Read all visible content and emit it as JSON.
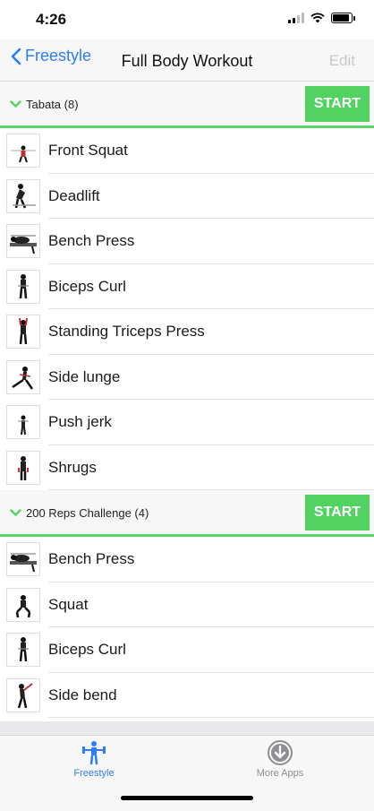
{
  "status": {
    "time": "4:26"
  },
  "nav": {
    "back_label": "Freestyle",
    "title": "Full Body Workout",
    "edit_label": "Edit"
  },
  "sections": [
    {
      "title": "Tabata (8)",
      "start_label": "START",
      "items": [
        {
          "name": "Front Squat"
        },
        {
          "name": "Deadlift"
        },
        {
          "name": "Bench Press"
        },
        {
          "name": "Biceps Curl"
        },
        {
          "name": "Standing Triceps Press"
        },
        {
          "name": "Side lunge"
        },
        {
          "name": "Push jerk"
        },
        {
          "name": "Shrugs"
        }
      ]
    },
    {
      "title": "200 Reps Challenge (4)",
      "start_label": "START",
      "items": [
        {
          "name": "Bench Press"
        },
        {
          "name": "Squat"
        },
        {
          "name": "Biceps Curl"
        },
        {
          "name": "Side bend"
        }
      ]
    }
  ],
  "tabs": [
    {
      "label": "Freestyle",
      "icon": "dumbbell-person-icon",
      "active": true
    },
    {
      "label": "More Apps",
      "icon": "download-circle-icon",
      "active": false
    }
  ],
  "colors": {
    "accent": "#2f7cf6",
    "start_green": "#52d261",
    "divider_green": "#5dd36a"
  }
}
